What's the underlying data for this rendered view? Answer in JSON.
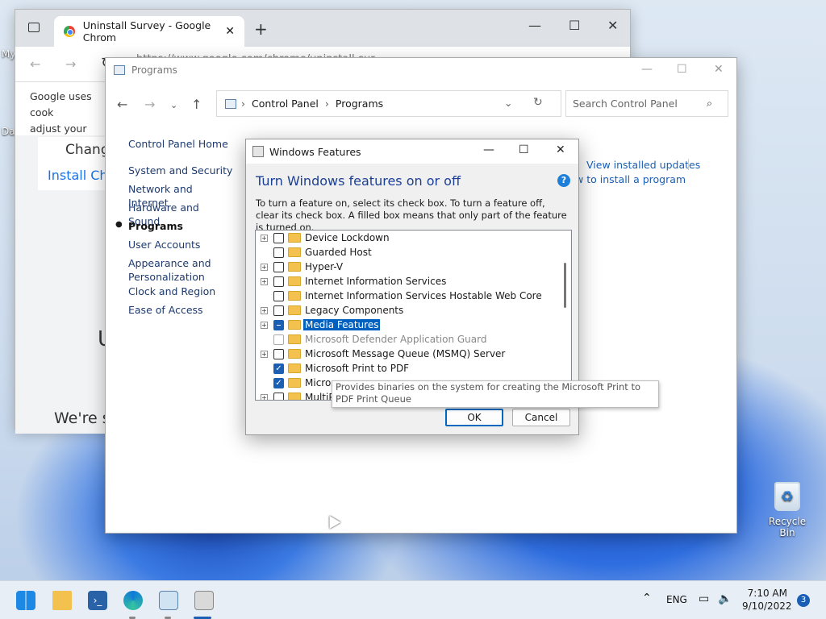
{
  "desktop": {
    "left_label_1": "My",
    "left_label_2": "Da",
    "recycle_label": "Recycle Bin"
  },
  "chrome": {
    "tab_title": "Uninstall Survey - Google Chrom",
    "url": "https://www.google.com/chrome/uninstall-sur",
    "consent_line1": "Google uses cook",
    "consent_line2": "adjust your privac",
    "heading_partial": "Change",
    "link_partial": "Install Chr",
    "u_partial": "U",
    "were_partial": "We're s"
  },
  "control_panel": {
    "window_title": "Programs",
    "breadcrumb_root": "Control Panel",
    "breadcrumb_current": "Programs",
    "search_placeholder": "Search Control Panel",
    "sidebar": [
      {
        "label": "Control Panel Home"
      },
      {
        "label": "System and Security"
      },
      {
        "label": "Network and Internet"
      },
      {
        "label": "Hardware and Sound"
      },
      {
        "label": "Programs"
      },
      {
        "label": "User Accounts"
      },
      {
        "label": "Appearance and Personalization"
      },
      {
        "label": "Clock and Region"
      },
      {
        "label": "Ease of Access"
      }
    ],
    "link_updates": "View installed updates",
    "link_install": "w to install a program"
  },
  "dialog": {
    "title": "Windows Features",
    "heading": "Turn Windows features on or off",
    "description": "To turn a feature on, select its check box. To turn a feature off, clear its check box. A filled box means that only part of the feature is turned on.",
    "features": [
      {
        "label": "Device Lockdown",
        "expand": "+",
        "state": "off"
      },
      {
        "label": "Guarded Host",
        "expand": "",
        "state": "off"
      },
      {
        "label": "Hyper-V",
        "expand": "+",
        "state": "off"
      },
      {
        "label": "Internet Information Services",
        "expand": "+",
        "state": "off"
      },
      {
        "label": "Internet Information Services Hostable Web Core",
        "expand": "",
        "state": "off"
      },
      {
        "label": "Legacy Components",
        "expand": "+",
        "state": "off"
      },
      {
        "label": "Media Features",
        "expand": "+",
        "state": "partial"
      },
      {
        "label": "Microsoft Defender Application Guard",
        "expand": "",
        "state": "disabled"
      },
      {
        "label": "Microsoft Message Queue (MSMQ) Server",
        "expand": "+",
        "state": "off"
      },
      {
        "label": "Microsoft Print to PDF",
        "expand": "",
        "state": "on"
      },
      {
        "label": "Micros",
        "expand": "",
        "state": "on"
      },
      {
        "label": "MultiP",
        "expand": "+",
        "state": "off"
      }
    ],
    "tooltip": "Provides binaries on the system for creating the Microsoft Print to PDF Print Queue",
    "ok_label": "OK",
    "cancel_label": "Cancel"
  },
  "taskbar": {
    "language": "ENG",
    "time": "7:10 AM",
    "date": "9/10/2022",
    "notification_count": "3"
  }
}
